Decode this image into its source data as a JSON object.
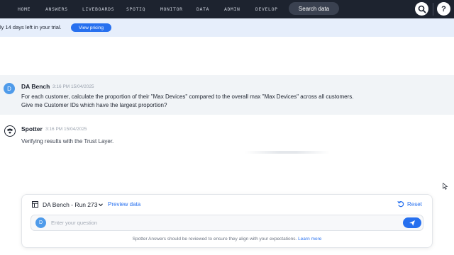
{
  "nav": {
    "items": [
      "HOME",
      "ANSWERS",
      "LIVEBOARDS",
      "SPOTIQ",
      "MONITOR",
      "DATA",
      "ADMIN",
      "DEVELOP"
    ],
    "search_label": "Search data",
    "help_label": "?"
  },
  "trial": {
    "text": "ly 14 days left in your trial.",
    "pricing_label": "View pricing"
  },
  "conversation": {
    "user": {
      "avatar_letter": "D",
      "author": "DA Bench",
      "time": "3:16 PM 15/04/2025",
      "text": "For each customer, calculate the proportion of their \"Max Devices\" compared to the overall max \"Max Devices\" across all customers. Give me Customer IDs which have the largest proportion?"
    },
    "spotter": {
      "author": "Spotter",
      "time": "3:16 PM 15/04/2025",
      "status": "Verifying results with the Trust Layer."
    }
  },
  "composer": {
    "data_source": "DA Bench - Run 273",
    "preview_label": "Preview data",
    "reset_label": "Reset",
    "avatar_letter": "D",
    "placeholder": "Enter your question",
    "disclaimer": "Spotter Answers should be reviewed to ensure they align with your expectations.",
    "learn_more": "Learn more"
  },
  "colors": {
    "nav_bg": "#1d232f",
    "accent": "#2770ef",
    "trial_bg": "#e6eefb",
    "user_msg_bg": "#f1f4f7"
  }
}
